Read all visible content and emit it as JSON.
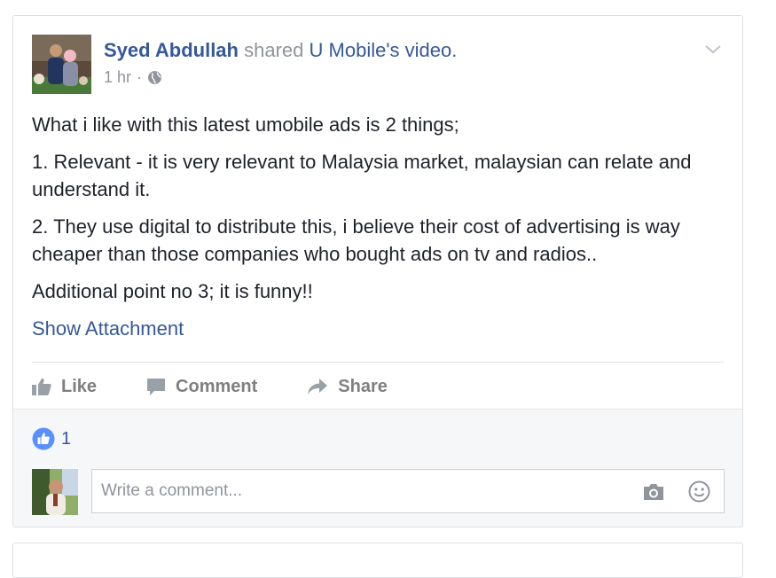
{
  "post": {
    "author": "Syed Abdullah",
    "shared_text": "shared",
    "shared_page": "U Mobile",
    "shared_suffix": "'s video.",
    "time": "1 hr",
    "separator": "·",
    "privacy_icon": "globe-icon",
    "menu_icon": "chevron-down-icon",
    "paragraphs": [
      "What i like with this latest umobile ads is 2 things;",
      "1. Relevant - it is very relevant to Malaysia market, malaysian can relate and understand it.",
      "2. They use digital to distribute this, i believe their cost of advertising is way cheaper than those companies who bought ads on tv and radios..",
      "Additional point no 3; it is funny!!"
    ],
    "attachment_link": "Show Attachment"
  },
  "actions": {
    "like": "Like",
    "comment": "Comment",
    "share": "Share"
  },
  "reactions": {
    "icon": "like-badge-icon",
    "count": "1"
  },
  "comment_box": {
    "placeholder": "Write a comment...",
    "camera_icon": "camera-icon",
    "emoji_icon": "smiley-icon"
  },
  "colors": {
    "link": "#365899",
    "muted": "#90949c",
    "text": "#1d2129",
    "action_gray": "#7f7f7f",
    "like_blue": "#5890ff",
    "footer_bg": "#f6f7f9"
  }
}
